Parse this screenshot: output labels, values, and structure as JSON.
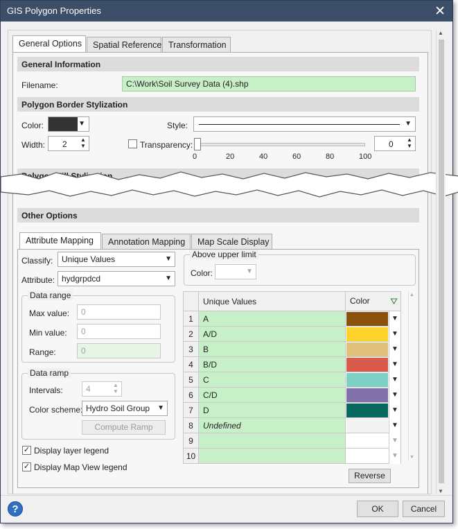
{
  "window": {
    "title": "GIS Polygon Properties"
  },
  "top_tabs": [
    "General Options",
    "Spatial Reference",
    "Transformation"
  ],
  "general_info": {
    "header": "General Information",
    "filename_label": "Filename:",
    "filename_value": "C:\\Work\\Soil Survey Data (4).shp"
  },
  "border": {
    "header": "Polygon Border Stylization",
    "color_label": "Color:",
    "color_value": "#333333",
    "style_label": "Style:",
    "width_label": "Width:",
    "width_value": "2",
    "transparency_label": "Transparency:",
    "transparency_value": "0",
    "transparency_level": 0,
    "slider_ticks": [
      "0",
      "20",
      "40",
      "60",
      "80",
      "100"
    ]
  },
  "fill": {
    "header": "Polygon Fill Stylization"
  },
  "other": {
    "header": "Other Options"
  },
  "sub_tabs": [
    "Attribute Mapping",
    "Annotation Mapping",
    "Map Scale Display"
  ],
  "mapping": {
    "classify_label": "Classify:",
    "classify_value": "Unique Values",
    "attribute_label": "Attribute:",
    "attribute_value": "hydgrpdcd"
  },
  "data_range": {
    "title": "Data range",
    "max_label": "Max value:",
    "max_value": "0",
    "min_label": "Min value:",
    "min_value": "0",
    "range_label": "Range:",
    "range_value": "0"
  },
  "data_ramp": {
    "title": "Data ramp",
    "intervals_label": "Intervals:",
    "intervals_value": "4",
    "scheme_label": "Color scheme:",
    "scheme_value": "Hydro Soil Group",
    "compute_label": "Compute Ramp"
  },
  "legend": {
    "layer_label": "Display layer legend",
    "mapview_label": "Display Map View legend"
  },
  "upper_limit": {
    "title": "Above upper limit",
    "color_label": "Color:"
  },
  "table": {
    "col_values": "Unique Values",
    "col_color": "Color",
    "rows": [
      {
        "num": "1",
        "value": "A",
        "color": "#8b520e"
      },
      {
        "num": "2",
        "value": "A/D",
        "color": "#fdd22a"
      },
      {
        "num": "3",
        "value": "B",
        "color": "#dfc17c"
      },
      {
        "num": "4",
        "value": "B/D",
        "color": "#d85b4b"
      },
      {
        "num": "5",
        "value": "C",
        "color": "#7dd0c3"
      },
      {
        "num": "6",
        "value": "C/D",
        "color": "#8272ab"
      },
      {
        "num": "7",
        "value": "D",
        "color": "#07685f"
      },
      {
        "num": "8",
        "value": "Undefined",
        "color": "#f3f3f3"
      },
      {
        "num": "9",
        "value": "",
        "color": "#ffffff"
      },
      {
        "num": "10",
        "value": "",
        "color": "#ffffff"
      }
    ],
    "reverse_label": "Reverse"
  },
  "footer": {
    "ok_label": "OK",
    "cancel_label": "Cancel"
  }
}
